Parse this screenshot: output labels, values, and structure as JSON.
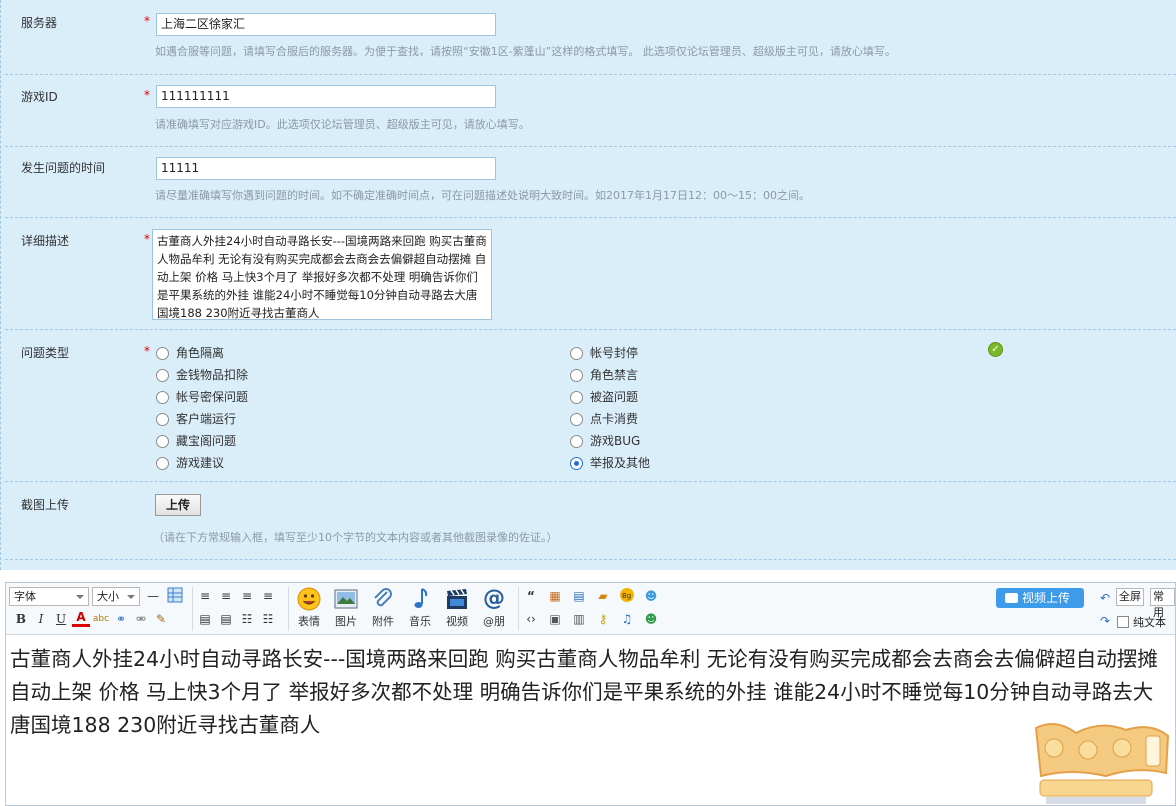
{
  "form": {
    "server": {
      "label": "服务器",
      "required": "*",
      "value": "上海二区徐家汇",
      "hint": "如遇合服等问题，请填写合服后的服务器。为便于查找，请按照“安徽1区-紫蓬山”这样的格式填写。 此选项仅论坛管理员、超级版主可见，请放心填写。"
    },
    "game_id": {
      "label": "游戏ID",
      "required": "*",
      "value": "111111111",
      "hint": "请准确填写对应游戏ID。此选项仅论坛管理员、超级版主可见，请放心填写。"
    },
    "time": {
      "label": "发生问题的时间",
      "value": "11111",
      "hint": "请尽量准确填写你遇到问题的时间。如不确定准确时间点，可在问题描述处说明大致时间。如2017年1月17日12：00～15：00之间。"
    },
    "description": {
      "label": "详细描述",
      "required": "*",
      "value": "古董商人外挂24小时自动寻路长安---国境两路来回跑 购买古董商人物品牟利 无论有没有购买完成都会去商会去偏僻超自动摆摊  自动上架 价格  马上快3个月了 举报好多次都不处理   明确告诉你们是平果系统的外挂  谁能24小时不睡觉每10分钟自动寻路去大唐国境188 230附近寻找古董商人"
    },
    "issue_type": {
      "label": "问题类型",
      "required": "*",
      "options_left": [
        "角色隔离",
        "金钱物品扣除",
        "帐号密保问题",
        "客户端运行",
        "藏宝阁问题",
        "游戏建议"
      ],
      "options_right": [
        "帐号封停",
        "角色禁言",
        "被盗问题",
        "点卡消费",
        "游戏BUG",
        "举报及其他"
      ],
      "selected": "举报及其他"
    },
    "screenshot": {
      "label": "截图上传",
      "button": "上传",
      "hint": "（请在下方常规输入框，填写至少10个字节的文本内容或者其他截图录像的佐证。）"
    }
  },
  "editor": {
    "font_select": "字体",
    "size_select": "大小",
    "big_buttons": [
      {
        "label": "表情",
        "icon": "smiley-icon"
      },
      {
        "label": "图片",
        "icon": "image-icon"
      },
      {
        "label": "附件",
        "icon": "paperclip-icon"
      },
      {
        "label": "音乐",
        "icon": "music-note-icon"
      },
      {
        "label": "视频",
        "icon": "video-clapper-icon"
      },
      {
        "label": "@朋",
        "icon": "at-icon"
      }
    ],
    "video_upload": "视频上传",
    "fullscreen": "全屏",
    "common": "常用",
    "plain_text": "纯文本",
    "content": "古董商人外挂24小时自动寻路长安---国境两路来回跑 购买古董商人物品牟利 无论有没有购买完成都会去商会去偏僻超自动摆摊  自动上架 价格  马上快3个月了 举报好多次都不处理   明确告诉你们是平果系统的外挂  谁能24小时不睡觉每10分钟自动寻路去大唐国境188 230附近寻找古董商人"
  },
  "colors": {
    "panel_bg": "#daeefa",
    "required_mark": "#e60000",
    "accent_blue": "#3d9be9",
    "checked_green": "#7ab829"
  }
}
